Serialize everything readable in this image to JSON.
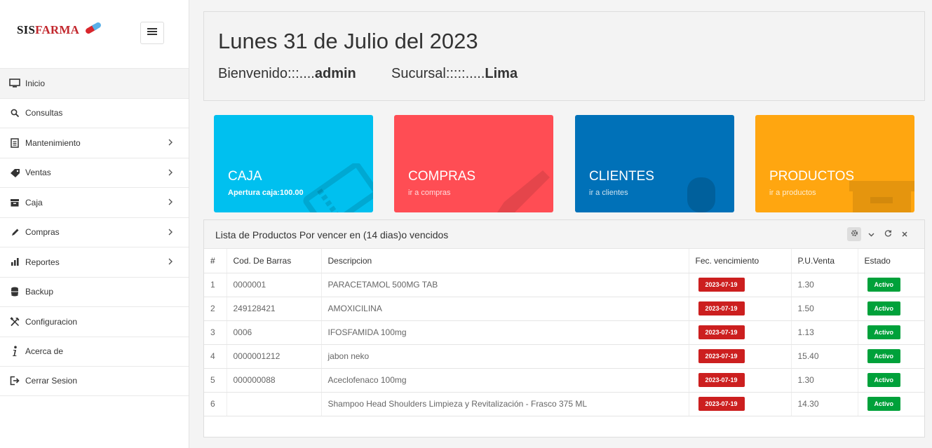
{
  "brand": {
    "part1": "SIS",
    "part2": "FARMA"
  },
  "sidebar": {
    "items": [
      {
        "label": "Inicio",
        "icon": "monitor-icon",
        "active": true,
        "submenu": false
      },
      {
        "label": "Consultas",
        "icon": "search-icon",
        "active": false,
        "submenu": false
      },
      {
        "label": "Mantenimiento",
        "icon": "document-icon",
        "active": false,
        "submenu": true
      },
      {
        "label": "Ventas",
        "icon": "tag-icon",
        "active": false,
        "submenu": true
      },
      {
        "label": "Caja",
        "icon": "inbox-icon",
        "active": false,
        "submenu": true
      },
      {
        "label": "Compras",
        "icon": "pencil-icon",
        "active": false,
        "submenu": true
      },
      {
        "label": "Reportes",
        "icon": "bar-chart-icon",
        "active": false,
        "submenu": true
      },
      {
        "label": "Backup",
        "icon": "database-icon",
        "active": false,
        "submenu": false
      },
      {
        "label": "Configuracion",
        "icon": "tools-icon",
        "active": false,
        "submenu": false
      },
      {
        "label": "Acerca de",
        "icon": "info-icon",
        "active": false,
        "submenu": false
      },
      {
        "label": "Cerrar Sesion",
        "icon": "logout-icon",
        "active": false,
        "submenu": false
      }
    ]
  },
  "header": {
    "date": "Lunes 31 de Julio del 2023",
    "welcome_label": "Bienvenido:::....",
    "user": "admin",
    "branch_label": "Sucursal:::::.....",
    "branch": "Lima"
  },
  "cards": [
    {
      "title": "CAJA",
      "subtitle": "Apertura caja:100.00",
      "color": "#00c0ef"
    },
    {
      "title": "COMPRAS",
      "subtitle": "ir a compras",
      "color": "#ff4d54"
    },
    {
      "title": "CLIENTES",
      "subtitle": "ir a clientes",
      "color": "#0071b8"
    },
    {
      "title": "PRODUCTOS",
      "subtitle": "ir a productos",
      "color": "#ffa610"
    }
  ],
  "table": {
    "title": "Lista de Productos Por vencer en (14 dias)o vencidos",
    "columns": [
      "#",
      "Cod. De Barras",
      "Descripcion",
      "Fec. vencimiento",
      "P.U.Venta",
      "Estado"
    ],
    "rows": [
      {
        "num": "1",
        "code": "0000001",
        "desc": "PARACETAMOL 500MG TAB",
        "date": "2023-07-19",
        "price": "1.30",
        "status": "Activo"
      },
      {
        "num": "2",
        "code": "249128421",
        "desc": "AMOXICILINA",
        "date": "2023-07-19",
        "price": "1.50",
        "status": "Activo"
      },
      {
        "num": "3",
        "code": "0006",
        "desc": "IFOSFAMIDA 100mg",
        "date": "2023-07-19",
        "price": "1.13",
        "status": "Activo"
      },
      {
        "num": "4",
        "code": "0000001212",
        "desc": "jabon neko",
        "date": "2023-07-19",
        "price": "15.40",
        "status": "Activo"
      },
      {
        "num": "5",
        "code": "000000088",
        "desc": "Aceclofenaco 100mg",
        "date": "2023-07-19",
        "price": "1.30",
        "status": "Activo"
      },
      {
        "num": "6",
        "code": "",
        "desc": "Shampoo Head Shoulders Limpieza y Revitalización - Frasco 375 ML",
        "date": "2023-07-19",
        "price": "14.30",
        "status": "Activo"
      }
    ]
  },
  "colors": {
    "date_badge": "#cc1f1f",
    "status_badge": "#00a13a",
    "brand_red": "#c2272d"
  }
}
